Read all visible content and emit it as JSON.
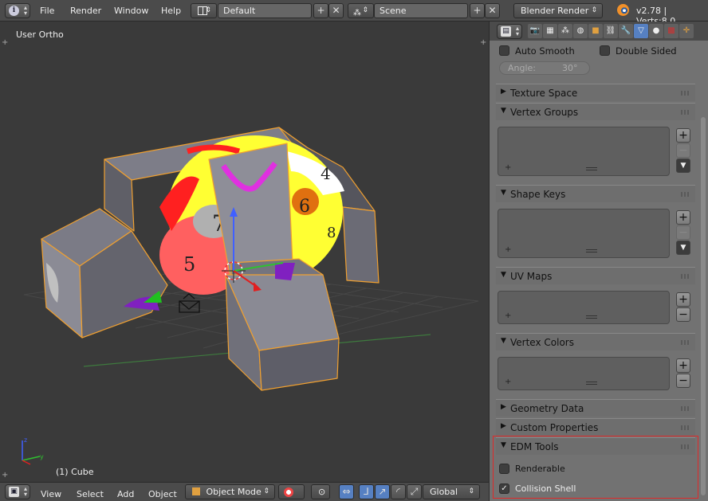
{
  "topbar": {
    "menus": [
      "File",
      "Render",
      "Window",
      "Help"
    ],
    "layout": "Default",
    "scene": "Scene",
    "engine": "Blender Render",
    "stats": "v2.78 | Verts:8,0"
  },
  "viewport": {
    "view_label": "User Ortho",
    "object_label": "(1) Cube",
    "clock_numbers": [
      "7",
      "5",
      "6",
      "4",
      "8"
    ]
  },
  "bottombar": {
    "menus": [
      "View",
      "Select",
      "Add",
      "Object"
    ],
    "mode": "Object Mode",
    "orientation": "Global"
  },
  "props": {
    "auto_smooth": "Auto Smooth",
    "double_sided": "Double Sided",
    "angle_label": "Angle:",
    "angle_value": "30°",
    "panels": {
      "texture_space": "Texture Space",
      "vertex_groups": "Vertex Groups",
      "shape_keys": "Shape Keys",
      "uv_maps": "UV Maps",
      "vertex_colors": "Vertex Colors",
      "geometry_data": "Geometry Data",
      "custom_properties": "Custom Properties",
      "edm_tools": "EDM Tools"
    },
    "renderable": "Renderable",
    "collision_shell": "Collision Shell",
    "renderable_checked": false,
    "collision_shell_checked": true
  },
  "colors": {
    "highlight_frame": "#e02a2a",
    "selection_outline": "#f0a030",
    "active_tab": "#5680c2"
  },
  "icons": [
    "info-icon",
    "layout-icon",
    "scene-icon",
    "blender-logo-icon",
    "cube-mode-icon",
    "manipulator-icon"
  ]
}
